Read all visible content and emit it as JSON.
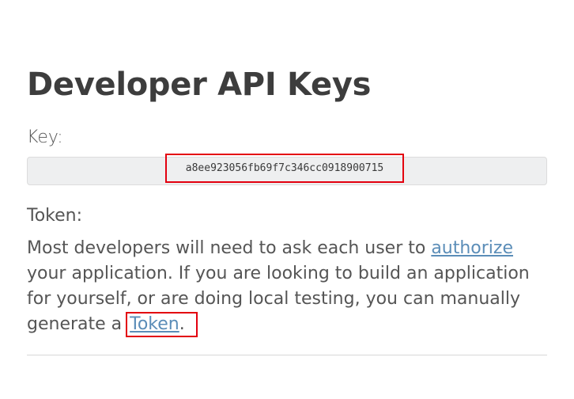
{
  "page": {
    "title": "Developer API Keys",
    "key_label": "Key:",
    "key_value": "a8ee923056fb69f7c346cc0918900715",
    "token_label": "Token:",
    "description": {
      "part1": "Most developers will need to ask each user to ",
      "authorize_link": "authorize",
      "part2": " your application. If you are looking to build an application for yourself, or are doing local testing, you can manually generate a ",
      "token_link": "Token",
      "part3": "."
    }
  },
  "colors": {
    "highlight": "#e3000f",
    "link": "#5b8db8",
    "text": "#555555",
    "title": "#3d3d3d"
  }
}
